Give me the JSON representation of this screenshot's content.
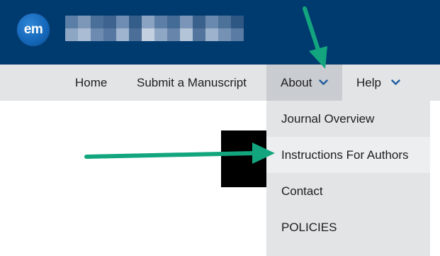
{
  "header": {
    "logo_text": "em",
    "brand_color": "#003b6f"
  },
  "nav": {
    "items": [
      {
        "label": "Home"
      },
      {
        "label": "Submit a Manuscript"
      },
      {
        "label": "About",
        "active": true,
        "has_dropdown": true
      },
      {
        "label": "Help",
        "has_dropdown": true
      }
    ]
  },
  "dropdown": {
    "items": [
      {
        "label": "Journal Overview"
      },
      {
        "label": "Instructions For Authors",
        "highlighted": true
      },
      {
        "label": "Contact"
      },
      {
        "label": "POLICIES"
      }
    ]
  },
  "annotations": {
    "arrow_color": "#13a67e",
    "chevron_color": "#1e5e9e"
  }
}
